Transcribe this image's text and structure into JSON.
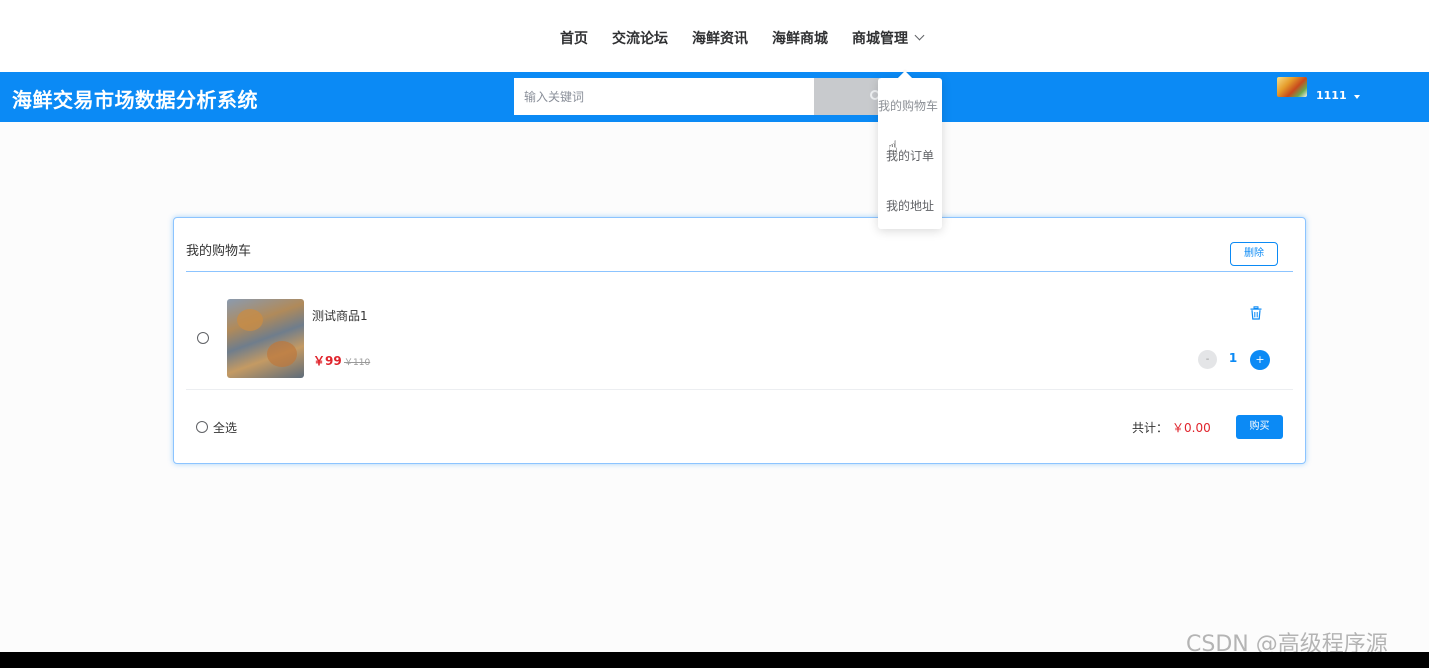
{
  "nav": {
    "items": [
      "首页",
      "交流论坛",
      "海鲜资讯",
      "海鲜商城",
      "商城管理"
    ]
  },
  "header": {
    "title": "海鲜交易市场数据分析系统",
    "search_placeholder": "输入关键词",
    "username": "1111"
  },
  "dropdown": {
    "items": [
      "我的购物车",
      "我的订单",
      "我的地址"
    ]
  },
  "cart": {
    "title": "我的购物车",
    "delete_label": "删除",
    "items": [
      {
        "name": "测试商品1",
        "price": "￥99",
        "original_price": "￥110",
        "quantity": "1"
      }
    ],
    "select_all_label": "全选",
    "total_label": "共计：",
    "total_value": "￥0.00",
    "buy_label": "购买"
  },
  "colors": {
    "primary": "#0b8af5",
    "price": "#e0242c"
  },
  "watermark": "CSDN @高级程序源"
}
